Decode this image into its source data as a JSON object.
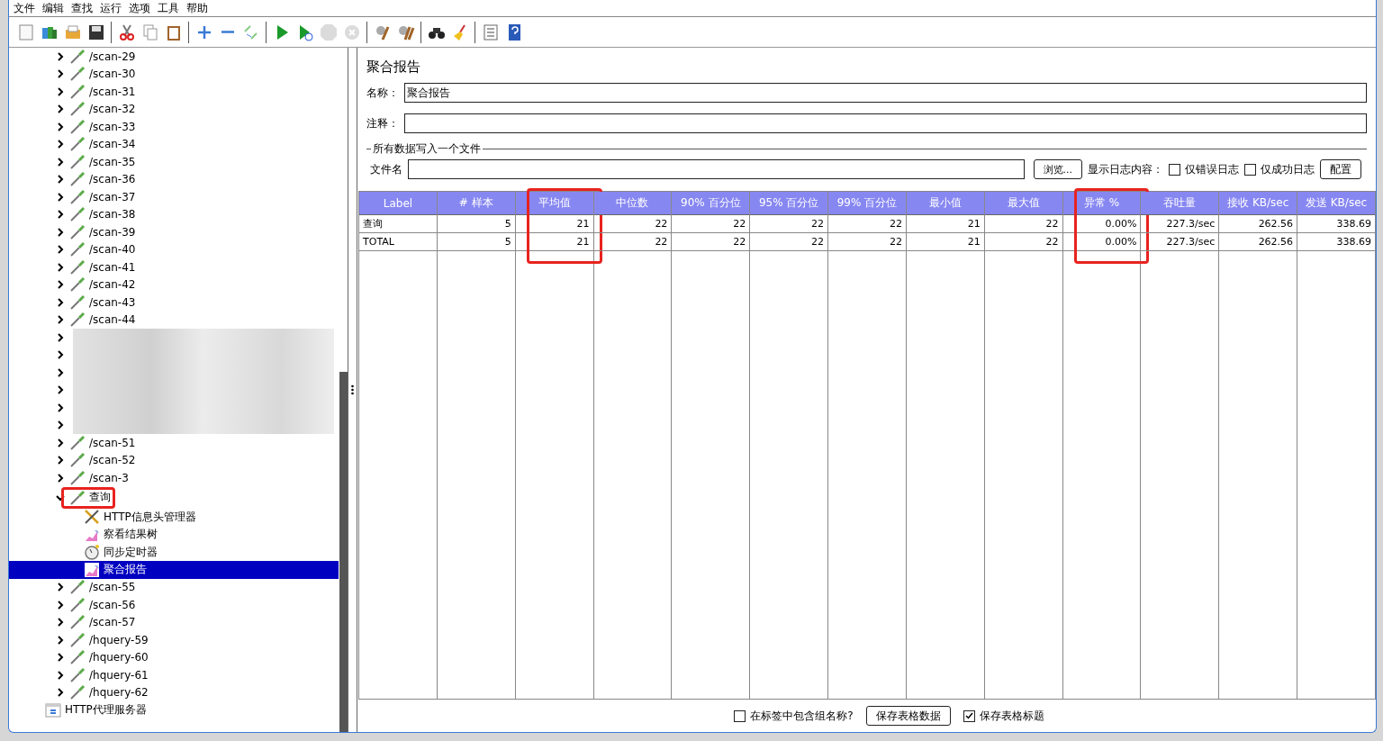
{
  "menu": [
    "文件",
    "编辑",
    "查找",
    "运行",
    "选项",
    "工具",
    "帮助"
  ],
  "toolbar": [
    {
      "kind": "new",
      "disabled": false
    },
    {
      "kind": "templates",
      "disabled": false
    },
    {
      "kind": "open",
      "disabled": false
    },
    {
      "kind": "save",
      "disabled": false
    },
    {
      "kind": "sep"
    },
    {
      "kind": "cut",
      "disabled": false
    },
    {
      "kind": "copy",
      "disabled": false
    },
    {
      "kind": "paste",
      "disabled": false
    },
    {
      "kind": "sep"
    },
    {
      "kind": "expand",
      "disabled": false
    },
    {
      "kind": "collapse",
      "disabled": false
    },
    {
      "kind": "toggle",
      "disabled": false
    },
    {
      "kind": "sep"
    },
    {
      "kind": "start",
      "disabled": false
    },
    {
      "kind": "start-nopause",
      "disabled": false
    },
    {
      "kind": "stop",
      "disabled": true
    },
    {
      "kind": "shutdown",
      "disabled": true
    },
    {
      "kind": "sep"
    },
    {
      "kind": "clear",
      "disabled": false
    },
    {
      "kind": "clear-all",
      "disabled": false
    },
    {
      "kind": "sep"
    },
    {
      "kind": "search",
      "disabled": false
    },
    {
      "kind": "reset-search",
      "disabled": false
    },
    {
      "kind": "sep"
    },
    {
      "kind": "log",
      "disabled": false
    },
    {
      "kind": "help",
      "disabled": false
    }
  ],
  "tree": {
    "samplers": [
      {
        "kind": "sampler",
        "label": "/scan-29",
        "expanded": false,
        "selected": false,
        "highlighted": false
      },
      {
        "kind": "sampler",
        "label": "/scan-30",
        "expanded": false,
        "selected": false,
        "highlighted": false
      },
      {
        "kind": "sampler",
        "label": "/scan-31",
        "expanded": false,
        "selected": false,
        "highlighted": false
      },
      {
        "kind": "sampler",
        "label": "/scan-32",
        "expanded": false,
        "selected": false,
        "highlighted": false
      },
      {
        "kind": "sampler",
        "label": "/scan-33",
        "expanded": false,
        "selected": false,
        "highlighted": false
      },
      {
        "kind": "sampler",
        "label": "/scan-34",
        "expanded": false,
        "selected": false,
        "highlighted": false
      },
      {
        "kind": "sampler",
        "label": "/scan-35",
        "expanded": false,
        "selected": false,
        "highlighted": false
      },
      {
        "kind": "sampler",
        "label": "/scan-36",
        "expanded": false,
        "selected": false,
        "highlighted": false
      },
      {
        "kind": "sampler",
        "label": "/scan-37",
        "expanded": false,
        "selected": false,
        "highlighted": false
      },
      {
        "kind": "sampler",
        "label": "/scan-38",
        "expanded": false,
        "selected": false,
        "highlighted": false
      },
      {
        "kind": "sampler",
        "label": "/scan-39",
        "expanded": false,
        "selected": false,
        "highlighted": false
      },
      {
        "kind": "sampler",
        "label": "/scan-40",
        "expanded": false,
        "selected": false,
        "highlighted": false
      },
      {
        "kind": "sampler",
        "label": "/scan-41",
        "expanded": false,
        "selected": false,
        "highlighted": false
      },
      {
        "kind": "sampler",
        "label": "/scan-42",
        "expanded": false,
        "selected": false,
        "highlighted": false
      },
      {
        "kind": "sampler",
        "label": "/scan-43",
        "expanded": false,
        "selected": false,
        "highlighted": false
      },
      {
        "kind": "sampler",
        "label": "/scan-44",
        "expanded": false,
        "selected": false,
        "highlighted": false
      },
      {
        "kind": "obscured"
      },
      {
        "kind": "obscured"
      },
      {
        "kind": "obscured"
      },
      {
        "kind": "obscured"
      },
      {
        "kind": "obscured"
      },
      {
        "kind": "obscured"
      },
      {
        "kind": "sampler",
        "label": "/scan-51",
        "expanded": false,
        "selected": false,
        "highlighted": false
      },
      {
        "kind": "sampler",
        "label": "/scan-52",
        "expanded": false,
        "selected": false,
        "highlighted": false
      },
      {
        "kind": "sampler",
        "label": "/scan-3",
        "expanded": false,
        "selected": false,
        "highlighted": false
      },
      {
        "kind": "sampler",
        "label": "查询",
        "expanded": true,
        "selected": false,
        "highlighted": true,
        "children": [
          {
            "kind": "header-manager",
            "label": "HTTP信息头管理器",
            "selected": false
          },
          {
            "kind": "results-tree",
            "label": "察看结果树",
            "selected": false
          },
          {
            "kind": "timer",
            "label": "同步定时器",
            "selected": false
          },
          {
            "kind": "report",
            "label": "聚合报告",
            "selected": true
          }
        ]
      },
      {
        "kind": "sampler",
        "label": "/scan-55",
        "expanded": false,
        "selected": false,
        "highlighted": false
      },
      {
        "kind": "sampler",
        "label": "/scan-56",
        "expanded": false,
        "selected": false,
        "highlighted": false
      },
      {
        "kind": "sampler",
        "label": "/scan-57",
        "expanded": false,
        "selected": false,
        "highlighted": false
      },
      {
        "kind": "sampler",
        "label": "/hquery-59",
        "expanded": false,
        "selected": false,
        "highlighted": false
      },
      {
        "kind": "sampler",
        "label": "/hquery-60",
        "expanded": false,
        "selected": false,
        "highlighted": false
      },
      {
        "kind": "sampler",
        "label": "/hquery-61",
        "expanded": false,
        "selected": false,
        "highlighted": false
      },
      {
        "kind": "sampler",
        "label": "/hquery-62",
        "expanded": false,
        "selected": false,
        "highlighted": false
      }
    ],
    "proxy": {
      "label": "HTTP代理服务器"
    }
  },
  "panel": {
    "title": "聚合报告",
    "name_label": "名称：",
    "name_value": "聚合报告",
    "comment_label": "注释：",
    "file_section": "所有数据写入一个文件",
    "file_label": "文件名",
    "browse": "浏览...",
    "log_label": "显示日志内容：",
    "errors_only": {
      "label": "仅错误日志",
      "checked": false
    },
    "success_only": {
      "label": "仅成功日志",
      "checked": false
    },
    "configure": "配置"
  },
  "table": {
    "columns": [
      {
        "label": "Label",
        "highlighted": false
      },
      {
        "label": "# 样本",
        "highlighted": false
      },
      {
        "label": "平均值",
        "highlighted": true
      },
      {
        "label": "中位数",
        "highlighted": false
      },
      {
        "label": "90% 百分位",
        "highlighted": false
      },
      {
        "label": "95% 百分位",
        "highlighted": false
      },
      {
        "label": "99% 百分位",
        "highlighted": false
      },
      {
        "label": "最小值",
        "highlighted": false
      },
      {
        "label": "最大值",
        "highlighted": false
      },
      {
        "label": "异常 %",
        "highlighted": true
      },
      {
        "label": "吞吐量",
        "highlighted": false
      },
      {
        "label": "接收 KB/sec",
        "highlighted": false
      },
      {
        "label": "发送 KB/sec",
        "highlighted": false
      }
    ],
    "rows": [
      [
        "查询",
        "5",
        "21",
        "22",
        "22",
        "22",
        "22",
        "21",
        "22",
        "0.00%",
        "227.3/sec",
        "262.56",
        "338.69"
      ],
      [
        "TOTAL",
        "5",
        "21",
        "22",
        "22",
        "22",
        "22",
        "21",
        "22",
        "0.00%",
        "227.3/sec",
        "262.56",
        "338.69"
      ]
    ]
  },
  "footer": {
    "include_group": {
      "label": "在标签中包含组名称?",
      "checked": false
    },
    "save_data": "保存表格数据",
    "save_header": {
      "label": "保存表格标题",
      "checked": true
    }
  }
}
